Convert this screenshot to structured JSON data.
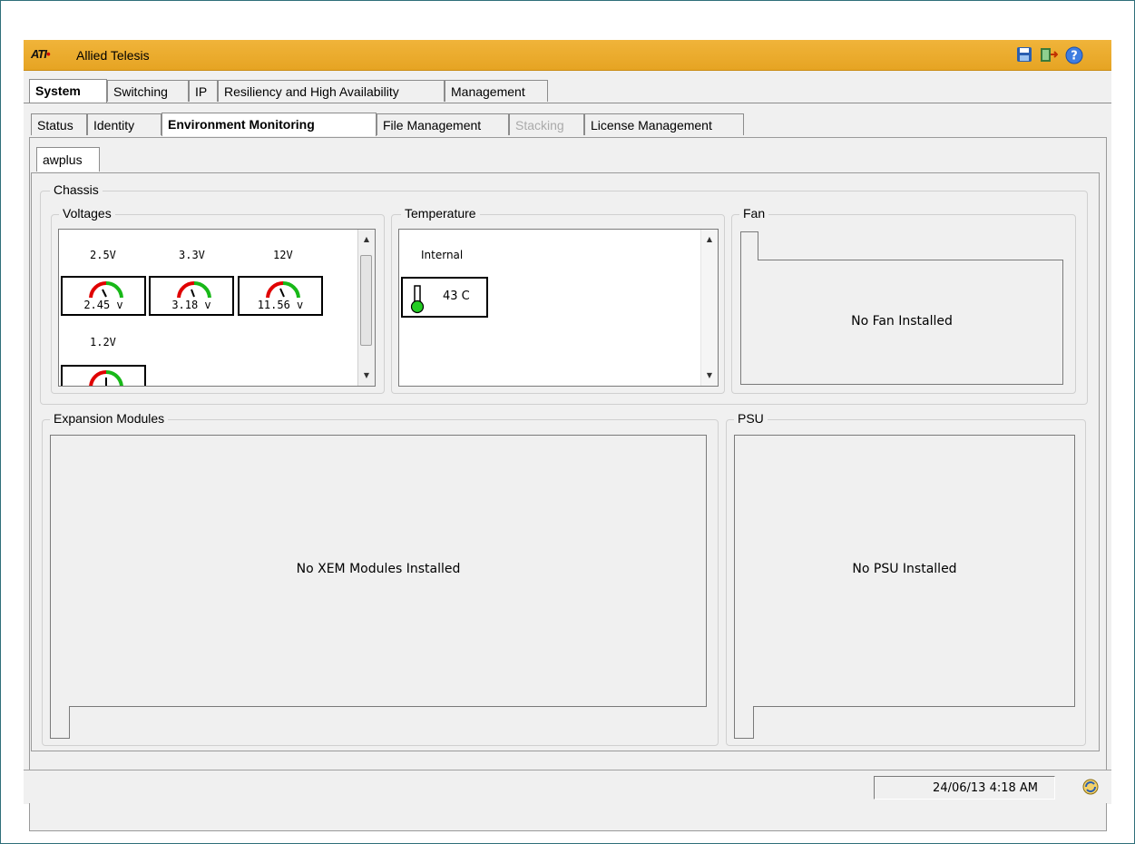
{
  "app": {
    "logo_text": "AT",
    "title": "Allied Telesis"
  },
  "title_icons": [
    "save-icon",
    "exit-icon",
    "help-icon"
  ],
  "main_tabs": [
    {
      "label": "System",
      "active": true
    },
    {
      "label": "Switching"
    },
    {
      "label": "IP"
    },
    {
      "label": "Resiliency and High Availability"
    },
    {
      "label": "Management"
    }
  ],
  "sub_tabs": [
    {
      "label": "Status"
    },
    {
      "label": "Identity"
    },
    {
      "label": "Environment Monitoring",
      "active": true
    },
    {
      "label": "File Management"
    },
    {
      "label": "Stacking",
      "disabled": true
    },
    {
      "label": "License Management"
    }
  ],
  "device_tab": "awplus",
  "chassis": {
    "legend": "Chassis",
    "voltages": {
      "legend": "Voltages",
      "sensors": [
        {
          "name": "2.5V",
          "value": "2.45 v"
        },
        {
          "name": "3.3V",
          "value": "3.18 v"
        },
        {
          "name": "12V",
          "value": "11.56 v"
        },
        {
          "name": "1.2V",
          "value": ""
        }
      ]
    },
    "temperature": {
      "legend": "Temperature",
      "sensor_name": "Internal",
      "value": "43 C"
    },
    "fan": {
      "legend": "Fan",
      "message": "No Fan Installed"
    }
  },
  "expansion": {
    "legend": "Expansion Modules",
    "message": "No XEM Modules Installed"
  },
  "psu": {
    "legend": "PSU",
    "message": "No PSU Installed"
  },
  "status_bar": {
    "datetime": "24/06/13 4:18 AM"
  },
  "colors": {
    "title_bar": "#e6a423",
    "gauge_red": "#e00000",
    "gauge_green": "#18b818",
    "thermo_green": "#22cc22"
  }
}
